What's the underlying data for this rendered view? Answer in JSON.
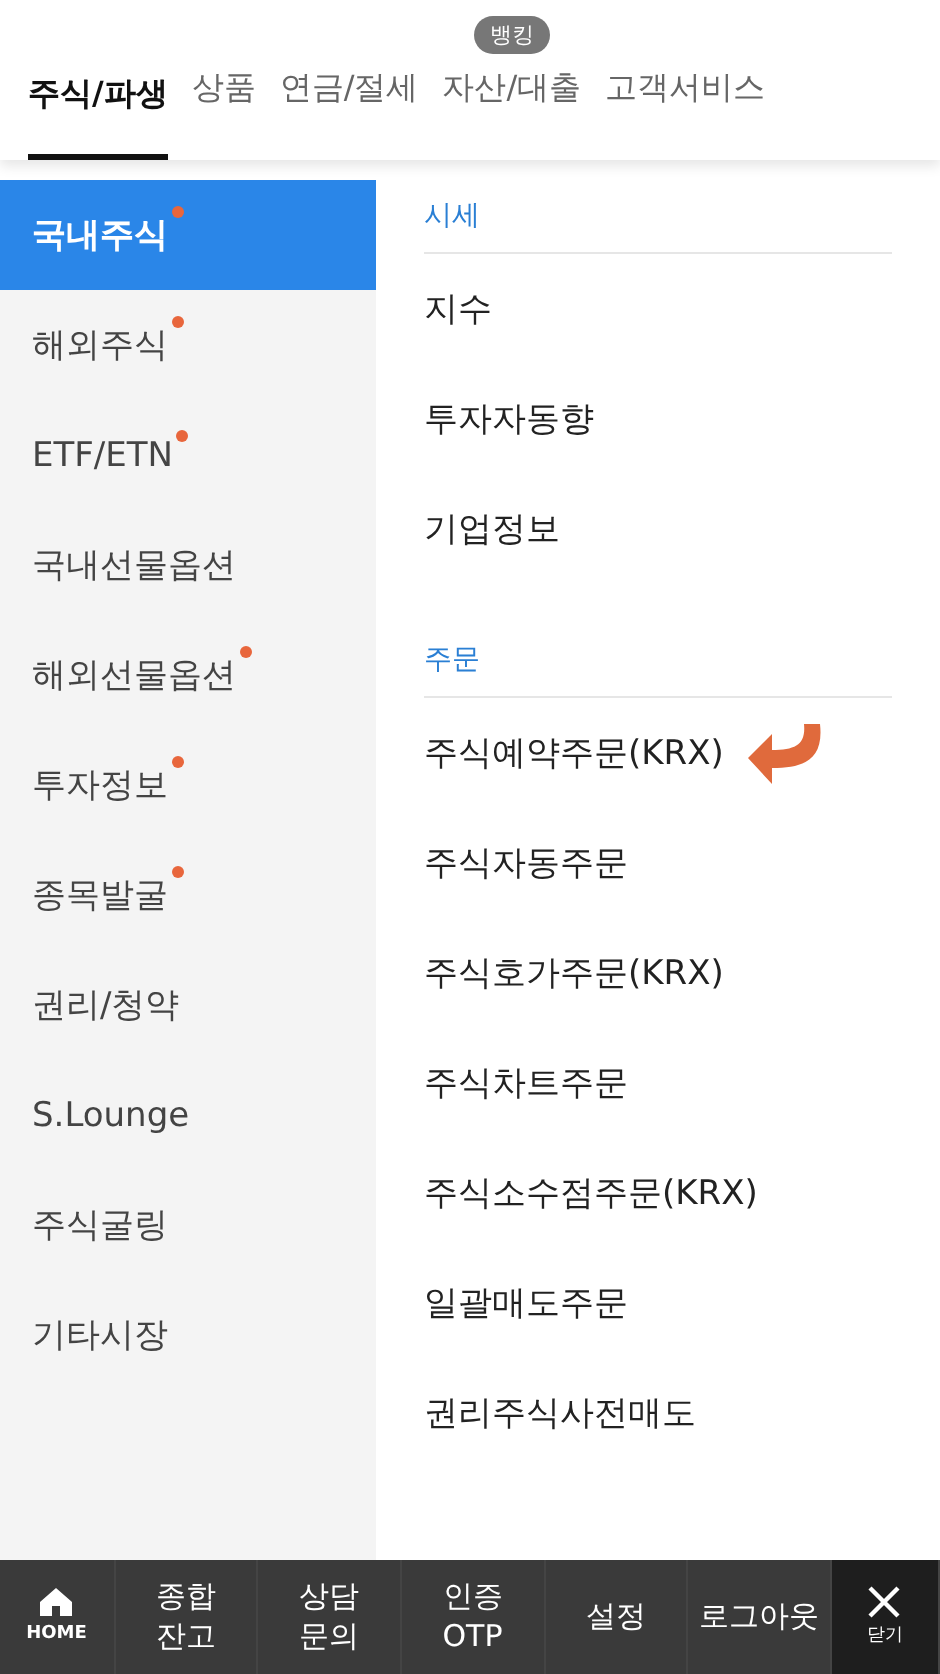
{
  "tabs": [
    {
      "label": "주식/파생",
      "selected": true
    },
    {
      "label": "상품",
      "selected": false
    },
    {
      "label": "연금/절세",
      "selected": false
    },
    {
      "label": "자산/대출",
      "selected": false,
      "badge": "뱅킹"
    },
    {
      "label": "고객서비스",
      "selected": false
    }
  ],
  "sidebar": {
    "items": [
      {
        "label": "국내주식",
        "selected": true,
        "new": true
      },
      {
        "label": "해외주식",
        "selected": false,
        "new": true
      },
      {
        "label": "ETF/ETN",
        "selected": false,
        "new": true
      },
      {
        "label": "국내선물옵션",
        "selected": false,
        "new": false
      },
      {
        "label": "해외선물옵션",
        "selected": false,
        "new": true
      },
      {
        "label": "투자정보",
        "selected": false,
        "new": true
      },
      {
        "label": "종목발굴",
        "selected": false,
        "new": true
      },
      {
        "label": "권리/청약",
        "selected": false,
        "new": false
      },
      {
        "label": "S.Lounge",
        "selected": false,
        "new": false
      },
      {
        "label": "주식굴링",
        "selected": false,
        "new": false
      },
      {
        "label": "기타시장",
        "selected": false,
        "new": false
      }
    ]
  },
  "sections": [
    {
      "title": "시세",
      "items": [
        {
          "label": "지수",
          "pointed": false
        },
        {
          "label": "투자자동향",
          "pointed": false
        },
        {
          "label": "기업정보",
          "pointed": false
        }
      ]
    },
    {
      "title": "주문",
      "items": [
        {
          "label": "주식예약주문(KRX)",
          "pointed": true
        },
        {
          "label": "주식자동주문",
          "pointed": false
        },
        {
          "label": "주식호가주문(KRX)",
          "pointed": false
        },
        {
          "label": "주식차트주문",
          "pointed": false
        },
        {
          "label": "주식소수점주문(KRX)",
          "pointed": false
        },
        {
          "label": "일괄매도주문",
          "pointed": false
        },
        {
          "label": "권리주식사전매도",
          "pointed": false
        }
      ]
    }
  ],
  "bottom_bar": {
    "home": "HOME",
    "items": [
      [
        "종합",
        "잔고"
      ],
      [
        "상담",
        "문의"
      ],
      [
        "인증",
        "OTP"
      ],
      [
        "설정"
      ],
      [
        "로그아웃"
      ]
    ],
    "close": "닫기"
  }
}
